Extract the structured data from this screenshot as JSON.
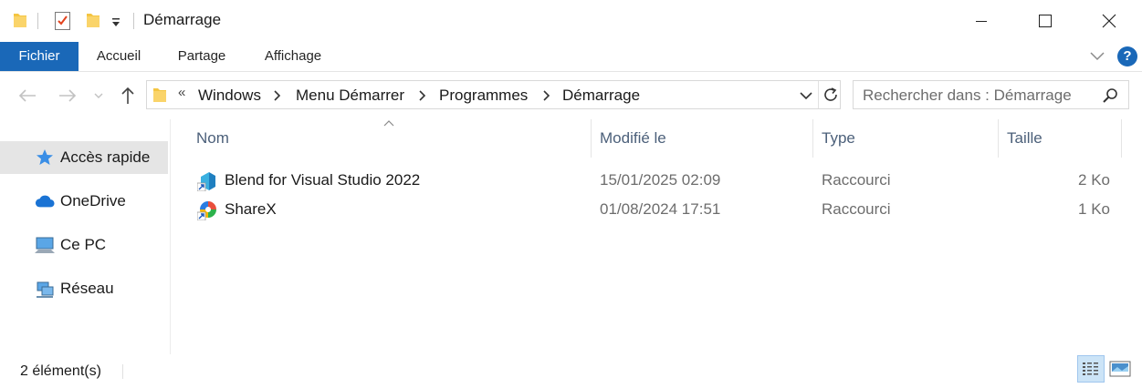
{
  "window": {
    "title": "Démarrage"
  },
  "ribbon": {
    "tabs": [
      {
        "label": "Fichier",
        "active": true
      },
      {
        "label": "Accueil"
      },
      {
        "label": "Partage"
      },
      {
        "label": "Affichage"
      }
    ],
    "help_label": "?"
  },
  "address": {
    "overflow": "«",
    "crumbs": [
      "Windows",
      "Menu Démarrer",
      "Programmes",
      "Démarrage"
    ]
  },
  "search": {
    "placeholder": "Rechercher dans : Démarrage"
  },
  "navpane": {
    "items": [
      {
        "label": "Accès rapide",
        "icon": "star-icon",
        "selected": true
      },
      {
        "label": "OneDrive",
        "icon": "cloud-icon"
      },
      {
        "label": "Ce PC",
        "icon": "computer-icon"
      },
      {
        "label": "Réseau",
        "icon": "network-icon"
      }
    ]
  },
  "filelist": {
    "columns": [
      "Nom",
      "Modifié le",
      "Type",
      "Taille"
    ],
    "rows": [
      {
        "name": "Blend for Visual Studio 2022",
        "modified": "15/01/2025 02:09",
        "type": "Raccourci",
        "size": "2 Ko",
        "icon": "blend-icon"
      },
      {
        "name": "ShareX",
        "modified": "01/08/2024 17:51",
        "type": "Raccourci",
        "size": "1 Ko",
        "icon": "sharex-icon"
      }
    ]
  },
  "status": {
    "count": "2 élément(s)"
  },
  "colors": {
    "accent": "#1a68b8",
    "selection": "#e5e5e5",
    "header_text": "#4c607a"
  }
}
